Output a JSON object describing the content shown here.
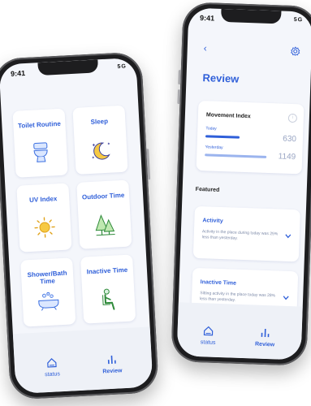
{
  "left_phone": {
    "time": "9:41",
    "signal": "5G",
    "cards": [
      {
        "label": "Toilet Routine",
        "icon": "toilet-icon"
      },
      {
        "label": "Sleep",
        "icon": "moon-stars-icon"
      },
      {
        "label": "UV Index",
        "icon": "sun-icon"
      },
      {
        "label": "Outdoor Time",
        "icon": "trees-icon"
      },
      {
        "label": "Shower/Bath Time",
        "icon": "bathtub-icon"
      },
      {
        "label": "Inactive Time",
        "icon": "seated-person-icon"
      }
    ],
    "tabs": [
      {
        "label": "status",
        "icon": "home-icon"
      },
      {
        "label": "Review",
        "icon": "bar-chart-icon"
      }
    ]
  },
  "right_phone": {
    "time": "9:41",
    "signal": "5G",
    "back_label": "‹",
    "title": "Review",
    "movement": {
      "title": "Movement Index",
      "info_label": "i",
      "today_label": "Today",
      "today_value": "630",
      "yesterday_label": "Yesterday",
      "yesterday_value": "1149",
      "today_color": "#2f5fd9",
      "yesterday_color": "#9bb4ee"
    },
    "featured_label": "Featured",
    "featured": [
      {
        "title": "Activity",
        "desc": "Activity in the place during today was 25% less than yesterday."
      },
      {
        "title": "Inactive Time",
        "desc": "Sitting activity in the place today was 28% less than yesterday."
      }
    ],
    "tabs": [
      {
        "label": "status",
        "icon": "home-icon"
      },
      {
        "label": "Review",
        "icon": "bar-chart-icon"
      }
    ]
  },
  "accent_color": "#2f5fd9"
}
